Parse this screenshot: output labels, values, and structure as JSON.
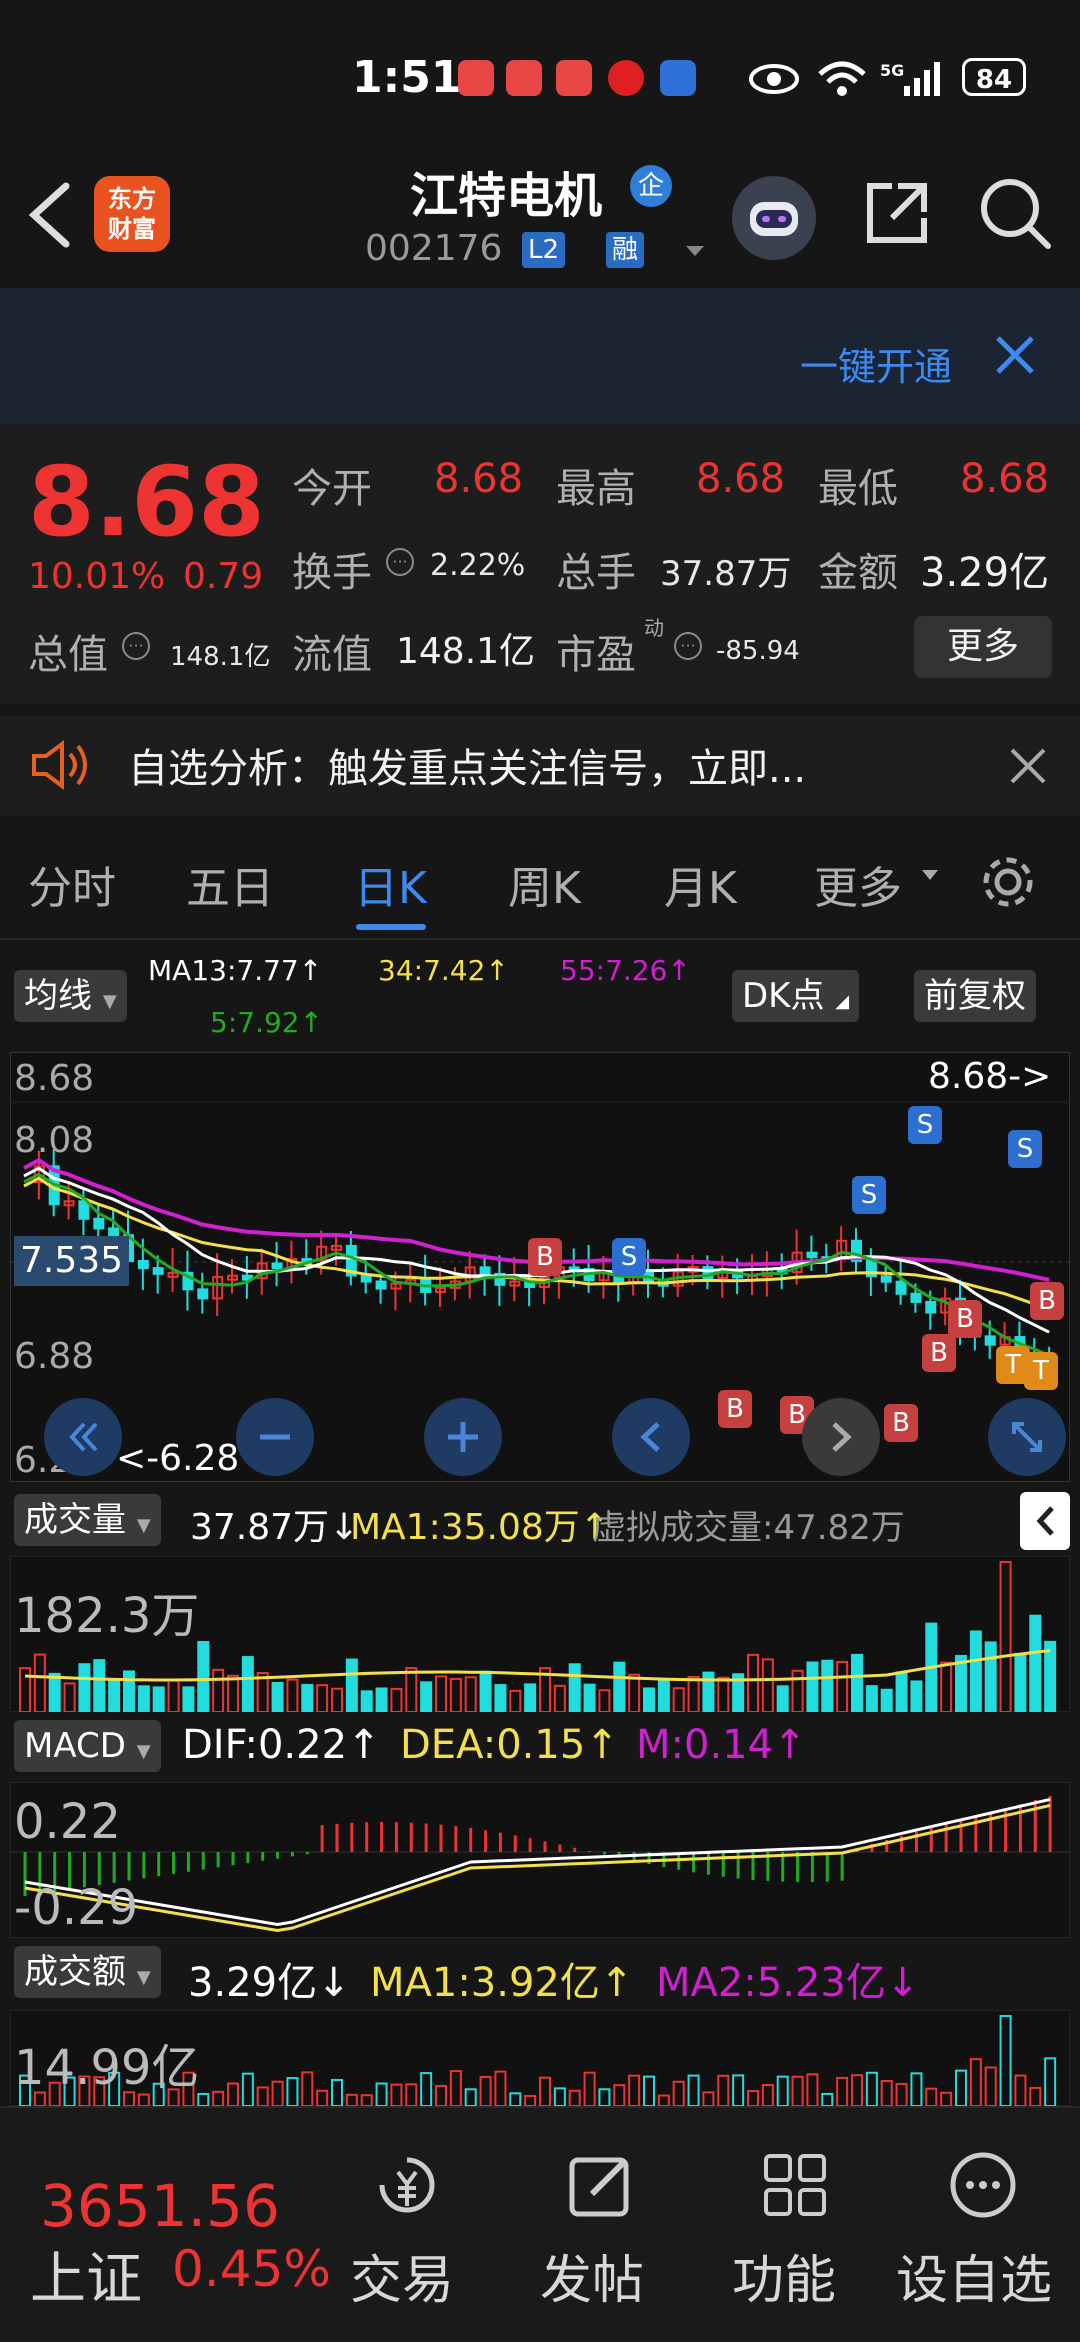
{
  "status": {
    "time": "1:51",
    "battery": "84"
  },
  "header": {
    "stock_name": "江特电机",
    "qi_badge": "企",
    "stock_code": "002176",
    "tag_l2": "L2",
    "tag_rong": "融",
    "logo_line1": "东方",
    "logo_line2": "财富"
  },
  "banner": {
    "text": "一键开通"
  },
  "quote": {
    "price": "8.68",
    "pct": "10.01%",
    "change": "0.79",
    "open_label": "今开",
    "open": "8.68",
    "high_label": "最高",
    "high": "8.68",
    "low_label": "最低",
    "low": "8.68",
    "turnover_label": "换手",
    "turnover": "2.22%",
    "vol_label": "总手",
    "vol": "37.87万",
    "amount_label": "金额",
    "amount": "3.29亿",
    "mktcap_label": "总值",
    "mktcap": "148.1亿",
    "float_label": "流值",
    "float": "148.1亿",
    "pe_label": "市盈",
    "pe_sup": "动",
    "pe": "-85.94",
    "more": "更多"
  },
  "notice": {
    "text": "自选分析：触发重点关注信号，立即..."
  },
  "tabs": [
    "分时",
    "五日",
    "日K",
    "周K",
    "月K",
    "更多"
  ],
  "ma_row": {
    "button": "均线",
    "ma13": "MA13:7.77↑",
    "ma34": "34:7.42↑",
    "ma55": "55:7.26↑",
    "ma5": "5:7.92↑",
    "dk": "DK点",
    "fq": "前复权"
  },
  "kline": {
    "y_top": "8.68",
    "y_2": "8.08",
    "y_cur": "7.535",
    "y_4": "6.88",
    "y_bottom": "6.28",
    "last_arrow": "8.68->",
    "min_arrow": "<-6.28",
    "colors": {
      "up": "#ee3333",
      "down": "#22dddd",
      "ma5": "#22aa22",
      "ma13": "#ffffff",
      "ma34": "#f4e04d",
      "ma55": "#d020d0"
    }
  },
  "volume": {
    "button": "成交量",
    "value": "37.87万↓",
    "ma1": "MA1:35.08万↑",
    "virtual": "虚拟成交量:47.82万",
    "max": "182.3万"
  },
  "macd": {
    "button": "MACD",
    "dif": "DIF:0.22↑",
    "dea": "DEA:0.15↑",
    "m": "M:0.14↑",
    "top": "0.22",
    "bottom": "-0.29"
  },
  "amount_panel": {
    "button": "成交额",
    "value": "3.29亿↓",
    "ma1": "MA1:3.92亿↑",
    "ma2": "MA2:5.23亿↓",
    "max": "14.99亿"
  },
  "bottom": {
    "index_value": "3651.56",
    "index_name": "上证",
    "index_pct": "0.45%",
    "trade": "交易",
    "post": "发帖",
    "func": "功能",
    "watch": "设自选"
  }
}
